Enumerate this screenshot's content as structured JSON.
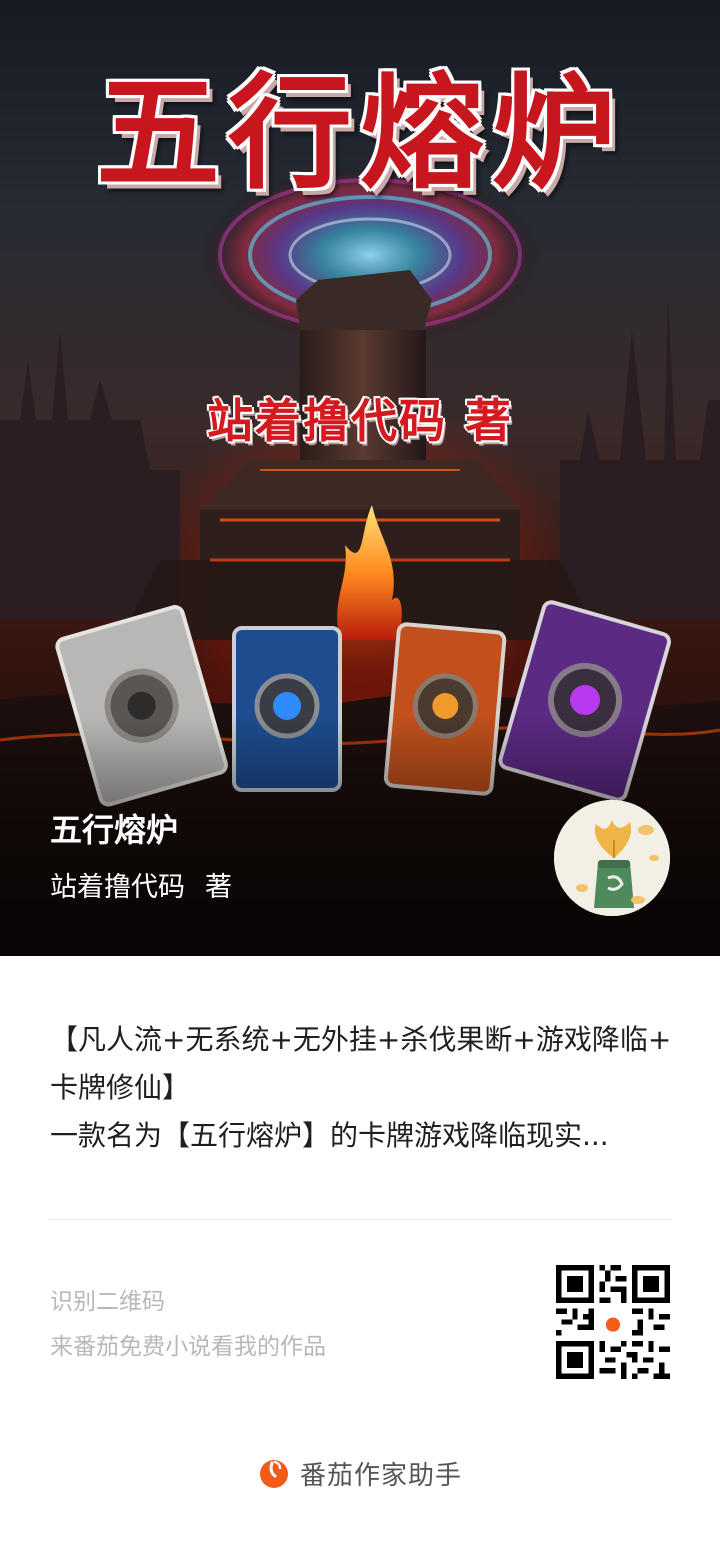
{
  "cover": {
    "title_art": "五行熔炉",
    "author_art": "站着撸代码 著",
    "title": "五行熔炉",
    "author": "站着撸代码",
    "author_suffix": "著"
  },
  "description": {
    "line1": "【凡人流+无系统+无外挂+杀伐果断+游戏降临+",
    "line2": "卡牌修仙】",
    "line3": "一款名为【五行熔炉】的卡牌游戏降临现实..."
  },
  "qr": {
    "line1": "识别二维码",
    "line2": "来番茄免费小说看我的作品"
  },
  "footer": {
    "brand": "番茄作家助手"
  },
  "colors": {
    "brand_orange": "#f25c19",
    "title_red": "#c8161e"
  },
  "icons": [
    "fanqie-logo-icon",
    "qr-code",
    "author-avatar"
  ]
}
